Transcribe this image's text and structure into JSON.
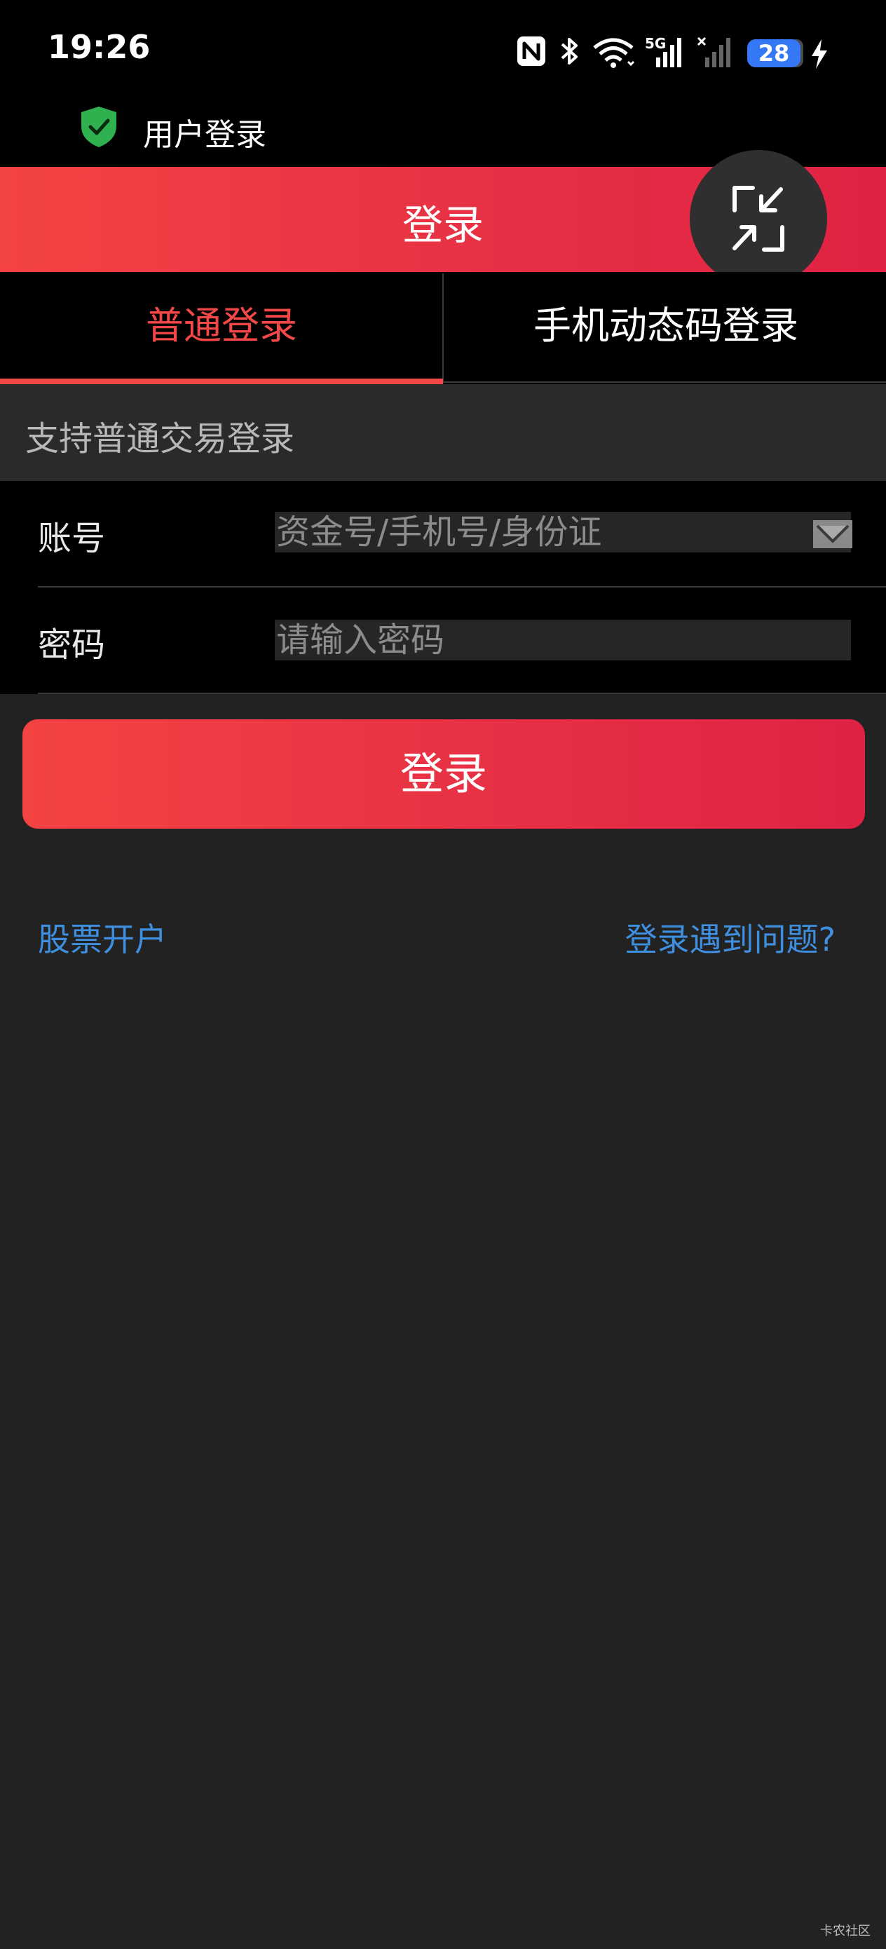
{
  "status_bar": {
    "time": "19:26",
    "network_label": "5G",
    "battery": "28",
    "icons": [
      "nfc-icon",
      "bluetooth-icon",
      "wifi-icon",
      "signal-5g-icon",
      "signal-no-sim-icon",
      "battery-icon",
      "charging-icon"
    ]
  },
  "app": {
    "title": "用户登录",
    "icon": "shield-check-icon"
  },
  "header": {
    "title": "登录",
    "float_button_icon": "collapse-arrows-icon"
  },
  "tabs": [
    {
      "label": "普通登录",
      "active": true
    },
    {
      "label": "手机动态码登录",
      "active": false
    }
  ],
  "hint": "支持普通交易登录",
  "form": {
    "account_label": "账号",
    "account_placeholder": "资金号/手机号/身份证",
    "password_label": "密码",
    "password_placeholder": "请输入密码"
  },
  "login_button": "登录",
  "links": {
    "open_account": "股票开户",
    "help": "登录遇到问题?"
  },
  "watermark": "卡农社区",
  "colors": {
    "accent_red": "#f44848",
    "link_blue": "#3e8fe0",
    "background": "#222222"
  }
}
